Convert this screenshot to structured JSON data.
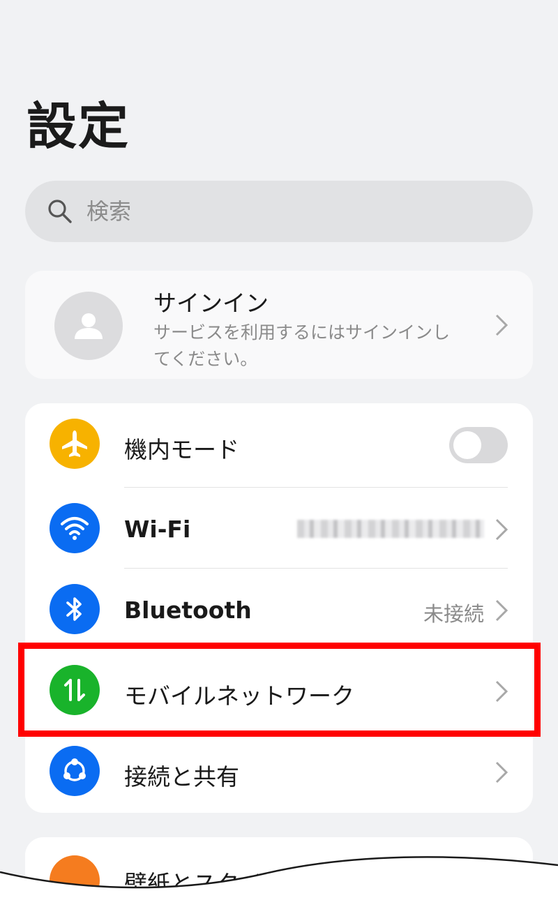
{
  "header": {
    "title": "設定"
  },
  "search": {
    "placeholder": "検索",
    "icon": "search-icon"
  },
  "account": {
    "title": "サインイン",
    "subtitle": "サービスを利用するにはサインインしてください。",
    "icon": "person-icon"
  },
  "settings": [
    {
      "id": "airplane",
      "label": "機内モード",
      "icon": "airplane-icon",
      "color": "#f7b200",
      "control": "toggle",
      "toggle_on": false
    },
    {
      "id": "wifi",
      "label": "Wi-Fi",
      "icon": "wifi-icon",
      "color": "#0a6cf2",
      "control": "chevron"
    },
    {
      "id": "bluetooth",
      "label": "Bluetooth",
      "value": "未接続",
      "icon": "bluetooth-icon",
      "color": "#0a6cf2",
      "control": "chevron"
    },
    {
      "id": "mobile",
      "label": "モバイルネットワーク",
      "icon": "mobile-data-icon",
      "color": "#19b32b",
      "control": "chevron",
      "highlighted": true
    },
    {
      "id": "share",
      "label": "接続と共有",
      "icon": "share-icon",
      "color": "#0a6cf2",
      "control": "chevron"
    }
  ],
  "next_section": {
    "label": "壁紙とスタイ",
    "icon": "palette-icon",
    "color": "#f57c1f"
  },
  "colors": {
    "background": "#f1f2f4",
    "highlight": "#ff0000"
  }
}
